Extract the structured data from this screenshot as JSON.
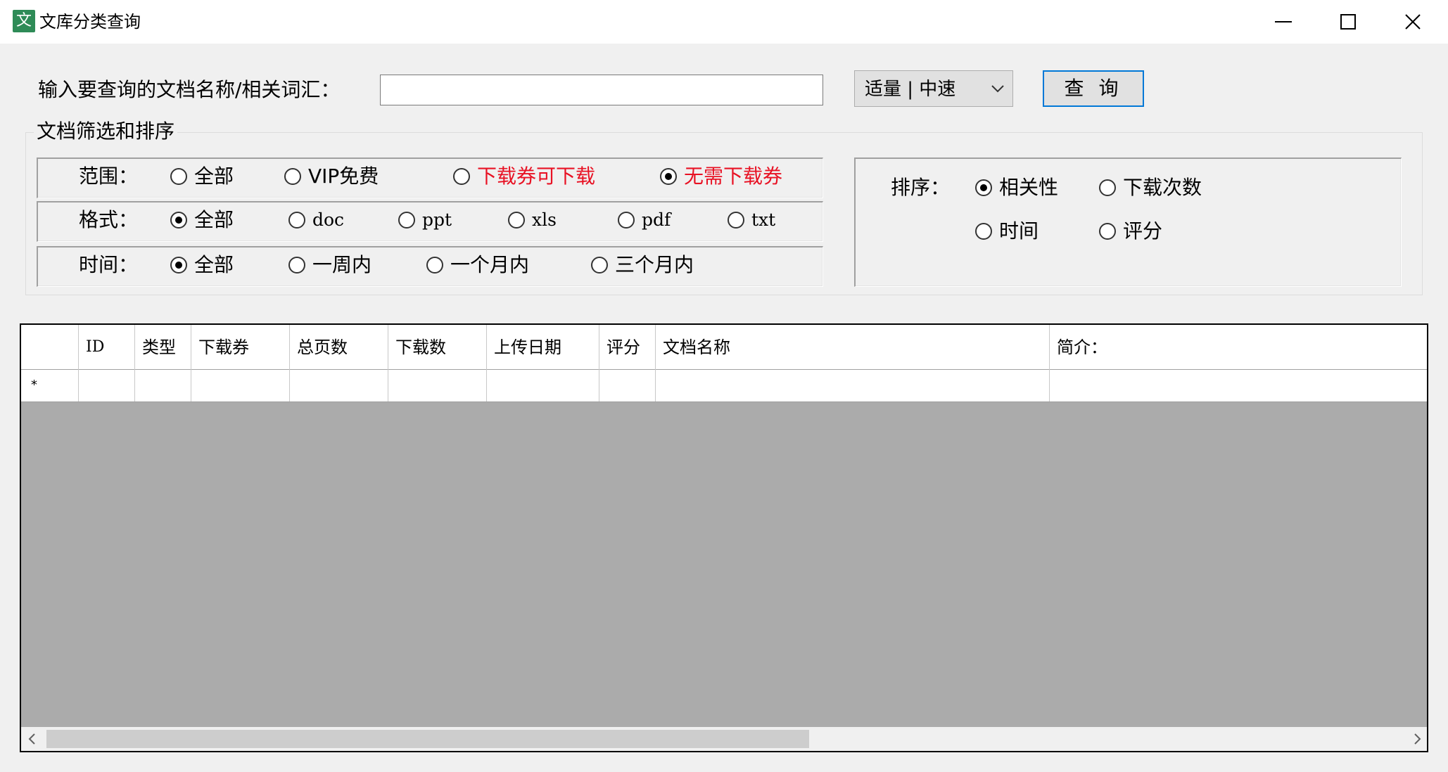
{
  "window": {
    "app_icon_glyph": "文",
    "title": "文库分类查询",
    "controls": {
      "minimize": "minimize-icon",
      "maximize": "maximize-icon",
      "close": "close-icon"
    }
  },
  "search": {
    "label": "输入要查询的文档名称/相关词汇：",
    "value": "",
    "speed_value": "适量 | 中速",
    "query_button": "查 询"
  },
  "filter_group": {
    "title": "文档筛选和排序",
    "range": {
      "label": "范围：",
      "options": [
        {
          "label": "全部",
          "checked": false,
          "color": "#000000"
        },
        {
          "label": "VIP免费",
          "checked": false,
          "color": "#000000"
        },
        {
          "label": "下载券可下载",
          "checked": false,
          "color": "#e81123"
        },
        {
          "label": "无需下载券",
          "checked": true,
          "color": "#e81123"
        }
      ]
    },
    "format": {
      "label": "格式：",
      "options": [
        {
          "label": "全部",
          "checked": true
        },
        {
          "label": "doc",
          "checked": false
        },
        {
          "label": "ppt",
          "checked": false
        },
        {
          "label": "xls",
          "checked": false
        },
        {
          "label": "pdf",
          "checked": false
        },
        {
          "label": "txt",
          "checked": false
        }
      ]
    },
    "time": {
      "label": "时间：",
      "options": [
        {
          "label": "全部",
          "checked": true
        },
        {
          "label": "一周内",
          "checked": false
        },
        {
          "label": "一个月内",
          "checked": false
        },
        {
          "label": "三个月内",
          "checked": false
        }
      ]
    },
    "sort": {
      "label": "排序：",
      "options": [
        {
          "label": "相关性",
          "checked": true
        },
        {
          "label": "下载次数",
          "checked": false
        },
        {
          "label": "时间",
          "checked": false
        },
        {
          "label": "评分",
          "checked": false
        }
      ]
    }
  },
  "grid": {
    "columns": [
      "ID",
      "类型",
      "下载券",
      "总页数",
      "下载数",
      "上传日期",
      "评分",
      "文档名称",
      "简介："
    ],
    "new_row_marker": "*",
    "colors": {
      "background": "#ababab",
      "accent": "#0078d7"
    }
  }
}
